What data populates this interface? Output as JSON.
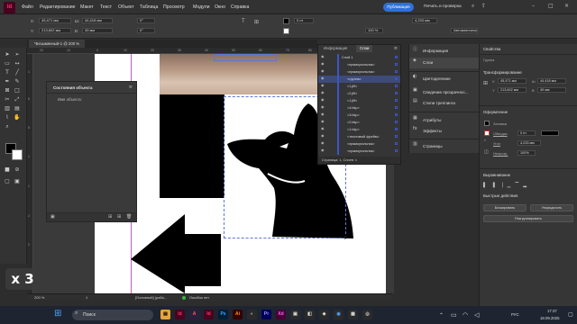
{
  "app": {
    "logo": "Id",
    "menus": [
      "Файл",
      "Редактирование",
      "Макет",
      "Текст",
      "Объект",
      "Таблица",
      "Просмотр",
      "Модули",
      "Окно",
      "Справка"
    ],
    "publish_label": "Публикация",
    "print_check_label": "Печать и проверка"
  },
  "control_bar": {
    "x_label": "X:",
    "x_value": "45,471 мм",
    "y_label": "Y:",
    "y_value": "213,602 мм",
    "w_label": "Ш:",
    "w_value": "44,418 мм",
    "h_label": "В:",
    "h_value": "49 мм",
    "angle_value": "0°",
    "shear_value": "0°",
    "stroke_value": "0 пт",
    "size_value": "4,233 мм",
    "zoom_value": "100 %",
    "auto_label": "Автоматическая"
  },
  "document": {
    "tab_label": "*Безымянный-1 @ 200 %",
    "ruler_ticks": [
      "20",
      "10",
      "0",
      "10",
      "20",
      "30",
      "40",
      "50",
      "60",
      "70",
      "80"
    ],
    "left_ruler_ticks": [
      "1",
      "6",
      "8",
      "1",
      "1",
      "2",
      "2",
      "2"
    ]
  },
  "status_bar": {
    "zoom": "200 %",
    "page": "1",
    "style": "[Основной] (рабо...",
    "errors": "Ошибок нет"
  },
  "object_states": {
    "title": "Состояния объекта",
    "name_label": "Имя объекта:"
  },
  "layers_panel": {
    "tabs": [
      "Информация",
      "Слои"
    ],
    "rows": [
      {
        "label": "Слой 1",
        "indent": 0,
        "selected": false
      },
      {
        "label": "<прямоугольник>",
        "indent": 1,
        "selected": false
      },
      {
        "label": "<прямоугольник>",
        "indent": 1,
        "selected": false
      },
      {
        "label": "<группа>",
        "indent": 1,
        "selected": true
      },
      {
        "label": "<1.jfif>",
        "indent": 1,
        "selected": false
      },
      {
        "label": "<2.jfif>",
        "indent": 1,
        "selected": false
      },
      {
        "label": "<1.jfif>",
        "indent": 1,
        "selected": false
      },
      {
        "label": "<4.bkp>",
        "indent": 1,
        "selected": false
      },
      {
        "label": "<3.bkp>",
        "indent": 1,
        "selected": false
      },
      {
        "label": "<2.bkp>",
        "indent": 1,
        "selected": false
      },
      {
        "label": "<1.bkp>",
        "indent": 1,
        "selected": false
      },
      {
        "label": "<текстовый фрейм>",
        "indent": 1,
        "selected": false
      },
      {
        "label": "<прямоугольник>",
        "indent": 1,
        "selected": false
      },
      {
        "label": "<прямоугольник>",
        "indent": 1,
        "selected": false
      }
    ],
    "status": "Страница: 1, Слоев: 1"
  },
  "dock": {
    "items": [
      {
        "label": "Информация",
        "icon": "info-icon",
        "glyph": "ⓘ"
      },
      {
        "label": "Слои",
        "icon": "layers-icon",
        "glyph": "◈"
      },
      {
        "label": "Цветоделение",
        "icon": "separations-icon",
        "glyph": "◐"
      },
      {
        "label": "Сведение прозрачнос...",
        "icon": "flattener-icon",
        "glyph": "▣"
      },
      {
        "label": "Стили треппинга",
        "icon": "trap-icon",
        "glyph": "▤"
      },
      {
        "label": "Атрибуты",
        "icon": "attributes-icon",
        "glyph": "▦"
      },
      {
        "label": "Эффекты",
        "icon": "effects-icon",
        "glyph": "fx"
      },
      {
        "label": "Страницы",
        "icon": "pages-icon",
        "glyph": "▥"
      }
    ]
  },
  "properties": {
    "tab_label": "Свойства",
    "group_label": "Группа",
    "transform_label": "Трансформирование",
    "x_label": "X",
    "x_value": "45,471 мм",
    "y_label": "Y",
    "y_value": "213,602 мм",
    "w_label": "Ш",
    "w_value": "44,418 мм",
    "h_label": "В",
    "h_value": "49 мм",
    "appearance_label": "Оформление",
    "fill_label": "Заливка",
    "stroke_label": "Обводка",
    "stroke_value": "0 пт",
    "corner_label": "Угол",
    "corner_value": "4,233 мм",
    "opacity_label": "Непрозр.",
    "opacity_value": "100%",
    "align_label": "Выравнивание",
    "quick_actions_label": "Быстрые действия",
    "ungroup_label": "Разгруппировать",
    "arrange_label": "Упорядочить",
    "ungroup_btn": "Разгруппировать",
    "group_btn": "Блокировать"
  },
  "badge": {
    "text": "x 3"
  },
  "taskbar": {
    "search_placeholder": "Поиск",
    "lang": "РУС",
    "time": "17:37",
    "date": "18.09.2025"
  }
}
